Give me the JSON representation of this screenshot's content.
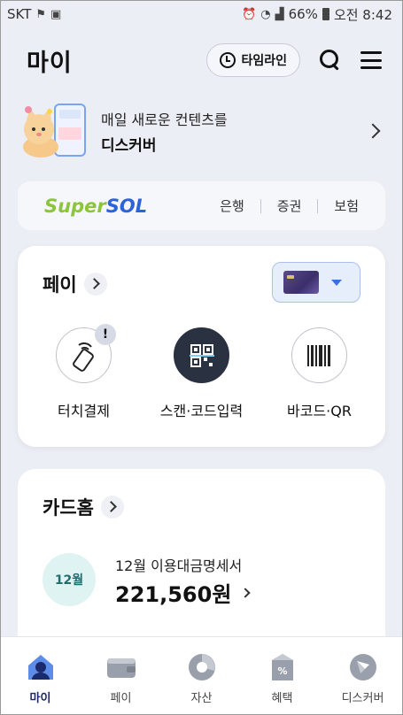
{
  "status_bar": {
    "carrier": "SKT",
    "battery": "66%",
    "time": "오전 8:42"
  },
  "header": {
    "title": "마이",
    "timeline_label": "타임라인"
  },
  "banner": {
    "line1": "매일 새로운 컨텐츠를",
    "line2": "디스커버"
  },
  "supersol": {
    "logo_super": "Super",
    "logo_sol": "SOL",
    "links": [
      "은행",
      "증권",
      "보험"
    ]
  },
  "pay": {
    "title": "페이",
    "actions": [
      {
        "label": "터치결제",
        "icon": "touch-pay-icon",
        "badge": "!"
      },
      {
        "label": "스캔·코드입력",
        "icon": "qr-scan-icon"
      },
      {
        "label": "바코드·QR",
        "icon": "barcode-icon"
      }
    ]
  },
  "card_home": {
    "title": "카드홈",
    "month_badge": "12월",
    "statement_title": "12월 이용대금명세서",
    "amount": "221,560원"
  },
  "bottom_nav": [
    {
      "label": "마이",
      "icon": "home-icon",
      "active": true
    },
    {
      "label": "페이",
      "icon": "wallet-icon"
    },
    {
      "label": "자산",
      "icon": "asset-chart-icon"
    },
    {
      "label": "혜택",
      "icon": "coupon-icon"
    },
    {
      "label": "디스커버",
      "icon": "compass-icon"
    }
  ],
  "colors": {
    "background": "#eceef6",
    "supersol_green": "#8cc43c",
    "supersol_blue": "#2c63d8",
    "month_badge_bg": "#dff3f2",
    "nav_active": "#1b2a6a"
  }
}
